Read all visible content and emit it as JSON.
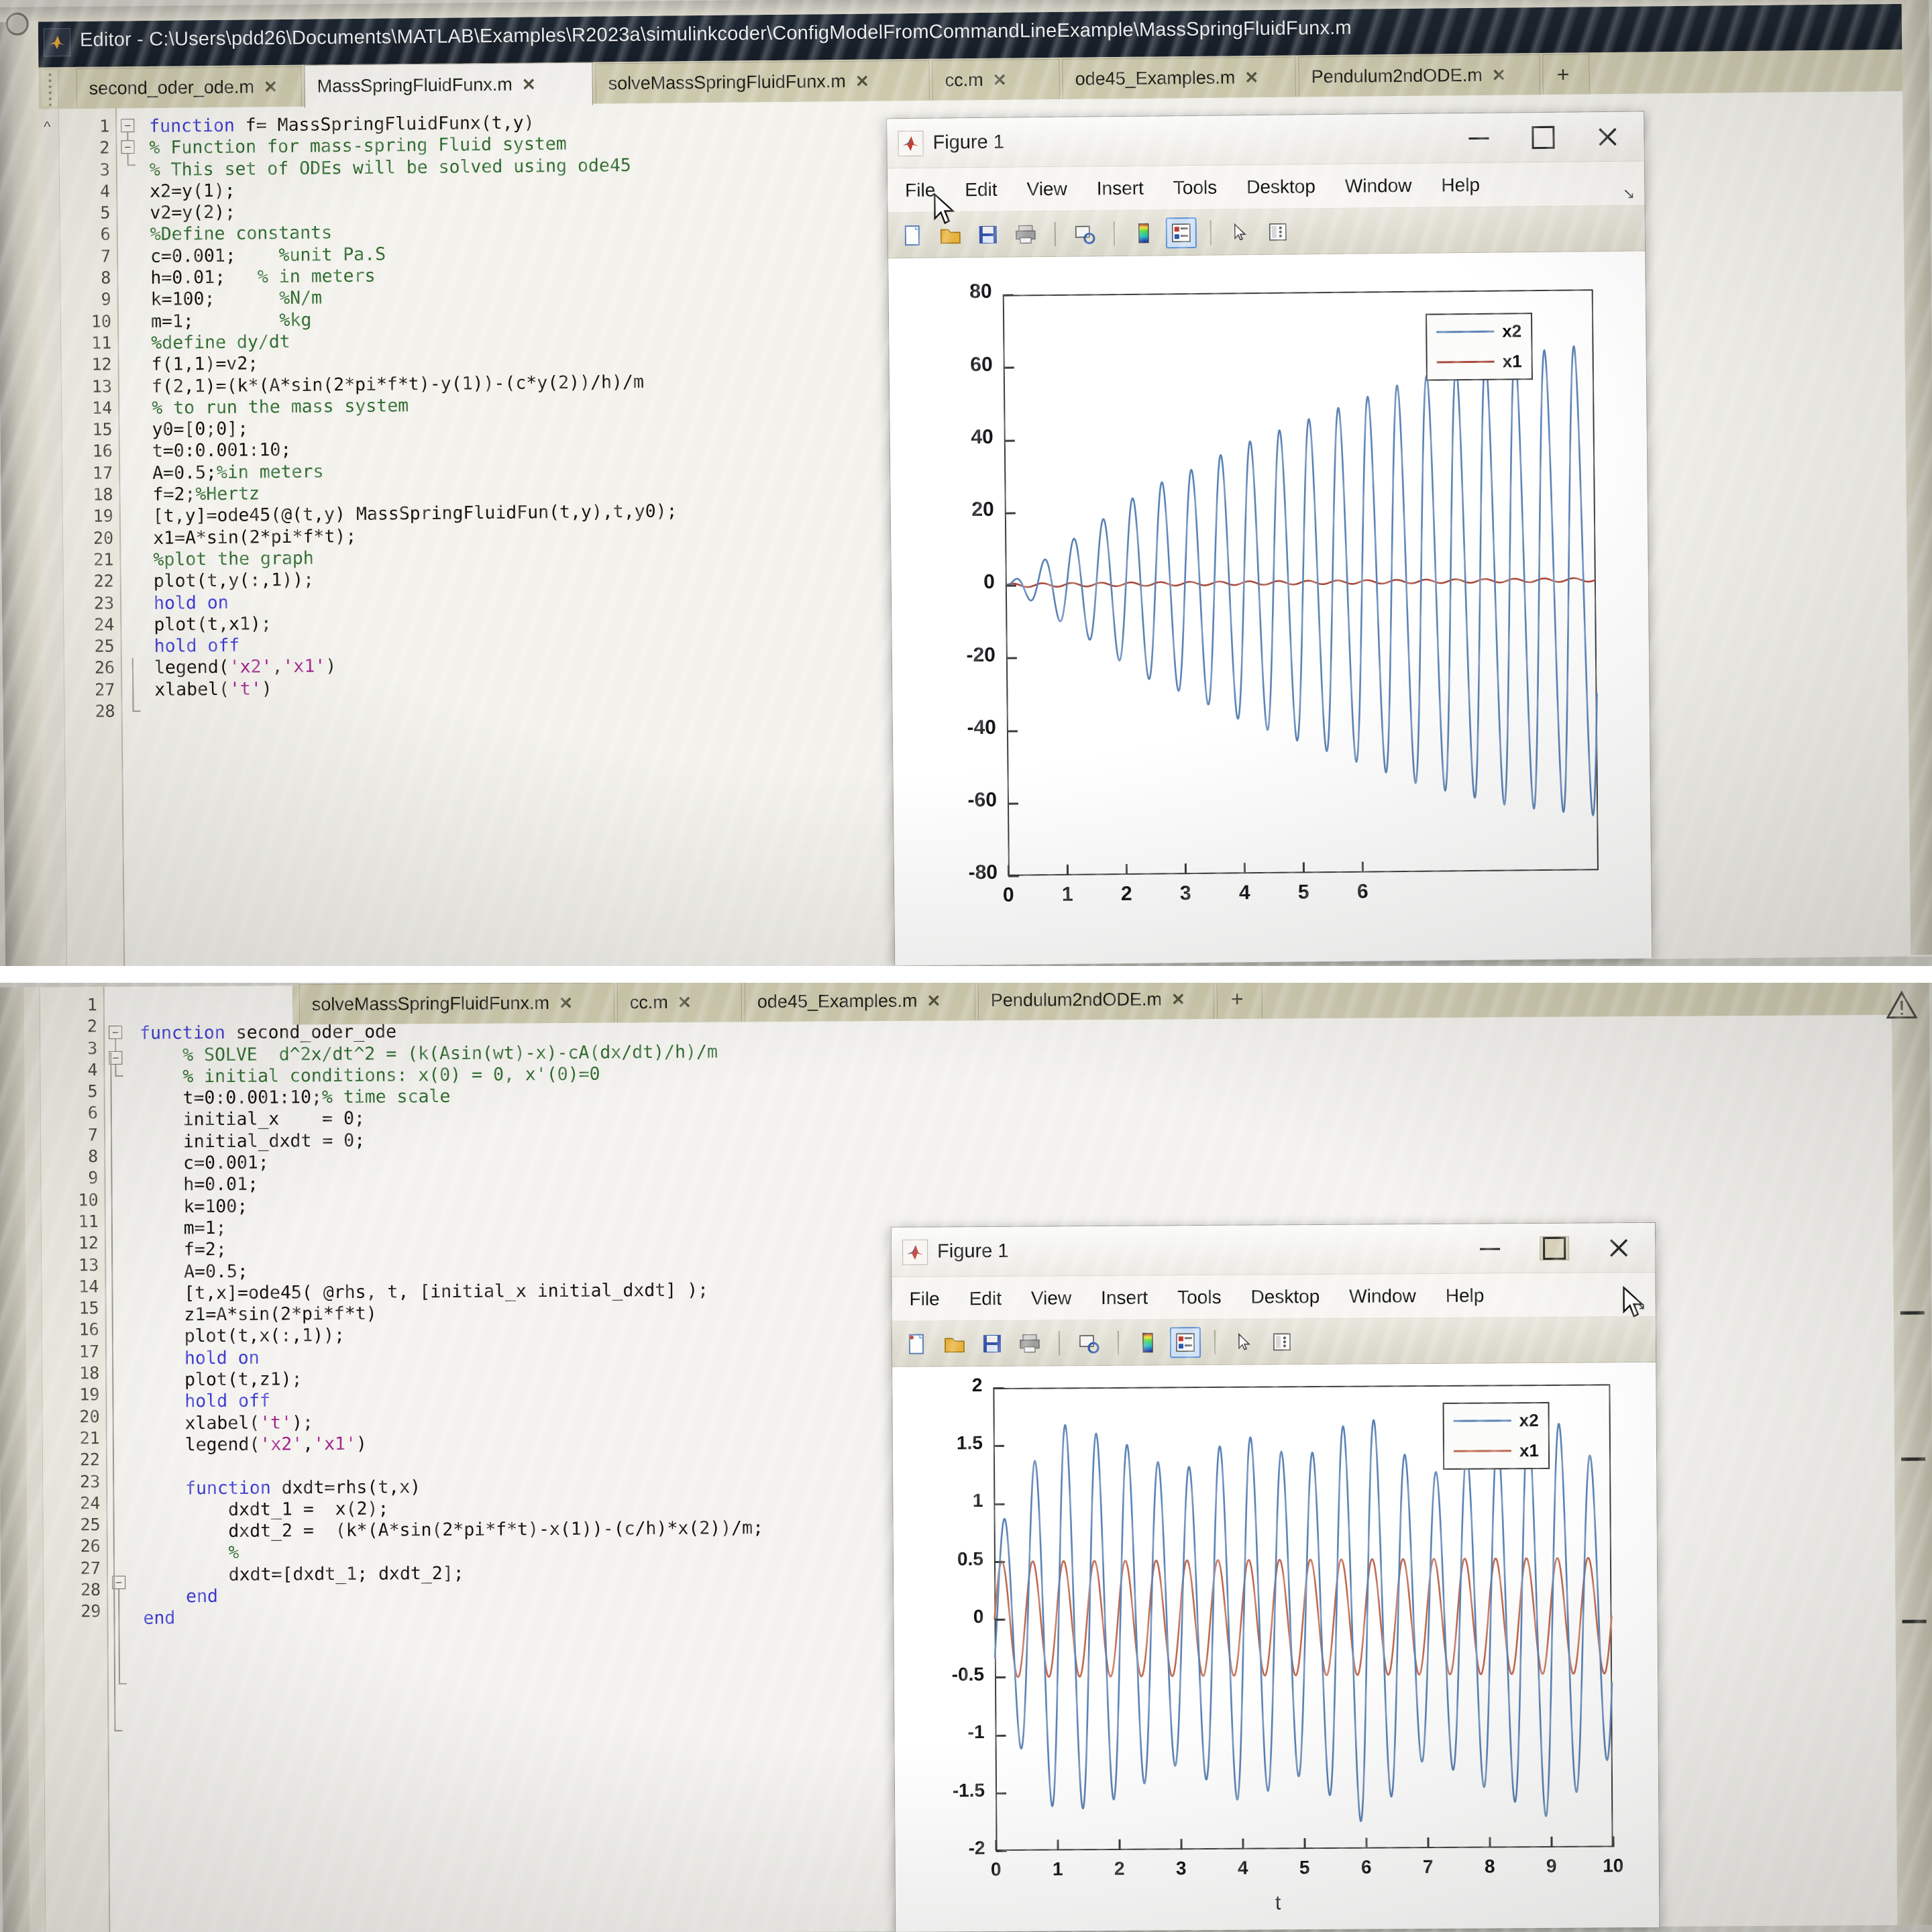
{
  "editor": {
    "window_title": "Editor - C:\\Users\\pdd26\\Documents\\MATLAB\\Examples\\R2023a\\simulinkcoder\\ConfigModelFromCommandLineExample\\MassSpringFluidFunx.m",
    "tabs": [
      {
        "label": "second_oder_ode.m",
        "close": "✕",
        "active": false
      },
      {
        "label": "MassSpringFluidFunx.m",
        "close": "✕",
        "active": true
      },
      {
        "label": "solveMassSpringFluidFunx.m",
        "close": "✕",
        "active": false
      },
      {
        "label": "cc.m",
        "close": "✕",
        "active": false
      },
      {
        "label": "ode45_Examples.m",
        "close": "✕",
        "active": false
      },
      {
        "label": "Pendulum2ndODE.m",
        "close": "✕",
        "active": false
      }
    ],
    "new_tab_label": "+",
    "top_code_lines": [
      "function f= MassSpringFluidFunx(t,y)",
      "% Function for mass-spring Fluid system",
      "% This set of ODEs will be solved using ode45",
      "x2=y(1);",
      "v2=y(2);",
      "%Define constants",
      "c=0.001;    %unit Pa.S",
      "h=0.01;   % in meters",
      "k=100;      %N/m",
      "m=1;        %kg",
      "%define dy/dt",
      "f(1,1)=v2;",
      "f(2,1)=(k*(A*sin(2*pi*f*t)-y(1))-(c*y(2))/h)/m",
      "% to run the mass system",
      "y0=[0;0];",
      "t=0:0.001:10;",
      "A=0.5;%in meters",
      "f=2;%Hertz",
      "[t,y]=ode45(@(t,y) MassSpringFluidFun(t,y),t,y0);",
      "x1=A*sin(2*pi*f*t);",
      "%plot the graph",
      "plot(t,y(:,1));",
      "hold on",
      "plot(t,x1);",
      "hold off",
      "legend('x2','x1')",
      "xlabel('t')",
      ""
    ],
    "top_line_numbers": [
      "1",
      "2",
      "3",
      "4",
      "5",
      "6",
      "7",
      "8",
      "9",
      "10",
      "11",
      "12",
      "13",
      "14",
      "15",
      "16",
      "17",
      "18",
      "19",
      "20",
      "21",
      "22",
      "23",
      "24",
      "25",
      "26",
      "27",
      "28"
    ],
    "bottom_code_lines": [
      "",
      "function second_oder_ode",
      "    % SOLVE  d^2x/dt^2 = (k(Asin(wt)-x)-cA(dx/dt)/h)/m",
      "    % initial conditions: x(0) = 0, x'(0)=0",
      "    t=0:0.001:10;% time scale",
      "    initial_x    = 0;",
      "    initial_dxdt = 0;",
      "    c=0.001;",
      "    h=0.01;",
      "    k=100;",
      "    m=1;",
      "    f=2;",
      "    A=0.5;",
      "    [t,x]=ode45( @rhs, t, [initial_x initial_dxdt] );",
      "    z1=A*sin(2*pi*f*t)",
      "    plot(t,x(:,1));",
      "    hold on",
      "    plot(t,z1);",
      "    hold off",
      "    xlabel('t');",
      "    legend('x2','x1')",
      "",
      "    function dxdt=rhs(t,x)",
      "        dxdt_1 =  x(2);",
      "        dxdt_2 =  (k*(A*sin(2*pi*f*t)-x(1))-(c/h)*x(2))/m;",
      "        %",
      "        dxdt=[dxdt_1; dxdt_2];",
      "    end",
      "end"
    ],
    "bottom_line_numbers": [
      "1",
      "2",
      "3",
      "4",
      "5",
      "6",
      "7",
      "8",
      "9",
      "10",
      "11",
      "12",
      "13",
      "14",
      "15",
      "16",
      "17",
      "18",
      "19",
      "20",
      "21",
      "22",
      "23",
      "24",
      "25",
      "26",
      "27",
      "28",
      "29"
    ],
    "bottom_tabs": [
      {
        "label": "solveMassSpringFluidFunx.m",
        "close": "✕"
      },
      {
        "label": "cc.m",
        "close": "✕"
      },
      {
        "label": "ode45_Examples.m",
        "close": "✕"
      },
      {
        "label": "Pendulum2ndODE.m",
        "close": "✕"
      }
    ]
  },
  "figure_top": {
    "title": "Figure 1",
    "logo_name": "matlab-logo-icon",
    "menus": [
      "File",
      "Edit",
      "View",
      "Insert",
      "Tools",
      "Desktop",
      "Window",
      "Help"
    ],
    "window_buttons": {
      "minimize": "–",
      "maximize": "□",
      "close": "✕"
    },
    "toolbar_icons": [
      "new-figure-icon",
      "open-file-icon",
      "save-icon",
      "print-icon",
      "link-plot-icon",
      "colorbar-icon",
      "legend-icon",
      "pointer-icon",
      "plot-browser-icon"
    ]
  },
  "figure_bottom": {
    "title": "Figure 1",
    "logo_name": "matlab-logo-icon",
    "menus": [
      "File",
      "Edit",
      "View",
      "Insert",
      "Tools",
      "Desktop",
      "Window",
      "Help"
    ],
    "window_buttons": {
      "minimize": "–",
      "maximize": "□",
      "close": "✕"
    },
    "toolbar_icons": [
      "new-figure-icon",
      "open-file-icon",
      "save-icon",
      "print-icon",
      "link-plot-icon",
      "colorbar-icon",
      "legend-icon",
      "pointer-icon",
      "plot-browser-icon"
    ]
  },
  "chart_data": [
    {
      "id": "top",
      "type": "line",
      "title": "",
      "xlabel": "",
      "ylabel": "",
      "xlim": [
        0,
        10
      ],
      "ylim": [
        -80,
        80
      ],
      "xticks": [
        "0",
        "1",
        "2",
        "3",
        "4",
        "5",
        "6"
      ],
      "yticks": [
        "80",
        "60",
        "40",
        "20",
        "0",
        "-20",
        "-40",
        "-60",
        "-80"
      ],
      "grid": false,
      "legend_position": "top-right",
      "series": [
        {
          "name": "x2",
          "color": "#5b83b5",
          "description": "growing resonant oscillation, amplitude ramps from ~5 at t=0.5 to ~65 near t=10, frequency 2 Hz"
        },
        {
          "name": "x1",
          "color": "#a94a3c",
          "description": "A*sin(2*pi*f*t) with A=0.5, nearly flat at this scale"
        }
      ],
      "x": [
        0,
        0.5,
        1,
        1.5,
        2,
        2.5,
        3,
        3.5,
        4,
        4.5,
        5,
        5.5,
        6,
        6.5,
        7,
        7.5,
        8,
        8.5,
        9,
        9.5,
        10
      ],
      "x2_envelope": [
        0,
        5,
        11,
        16,
        22,
        27,
        30,
        34,
        38,
        41,
        44,
        47,
        50,
        53,
        56,
        58,
        60,
        62,
        63,
        64,
        65
      ],
      "x1_amplitude": 0.5
    },
    {
      "id": "bottom",
      "type": "line",
      "title": "",
      "xlabel": "t",
      "ylabel": "",
      "xlim": [
        0,
        10
      ],
      "ylim": [
        -2,
        2
      ],
      "xticks": [
        "0",
        "1",
        "2",
        "3",
        "4",
        "5",
        "6",
        "7",
        "8",
        "9",
        "10"
      ],
      "yticks": [
        "2",
        "1.5",
        "1",
        "0.5",
        "0",
        "-0.5",
        "-1",
        "-1.5",
        "-2"
      ],
      "grid": false,
      "legend_position": "top-right",
      "series": [
        {
          "name": "x2",
          "color": "#5b83b5",
          "description": "solution x(:,1): beating oscillation, peaks up to ~1.85, frequency ~2 Hz with slow beat envelope"
        },
        {
          "name": "x1",
          "color": "#bf6a52",
          "description": "z1 = A*sin(2*pi*f*t), A=0.5, steady +/-0.5 sine at 2 Hz"
        }
      ],
      "x": [
        0,
        1,
        2,
        3,
        4,
        5,
        6,
        7,
        8,
        9,
        10
      ],
      "x2_envelope": [
        0.7,
        1.7,
        1.55,
        1.25,
        1.6,
        1.35,
        1.8,
        1.2,
        1.5,
        1.75,
        1.2
      ],
      "x1_amplitude": 0.5
    }
  ]
}
